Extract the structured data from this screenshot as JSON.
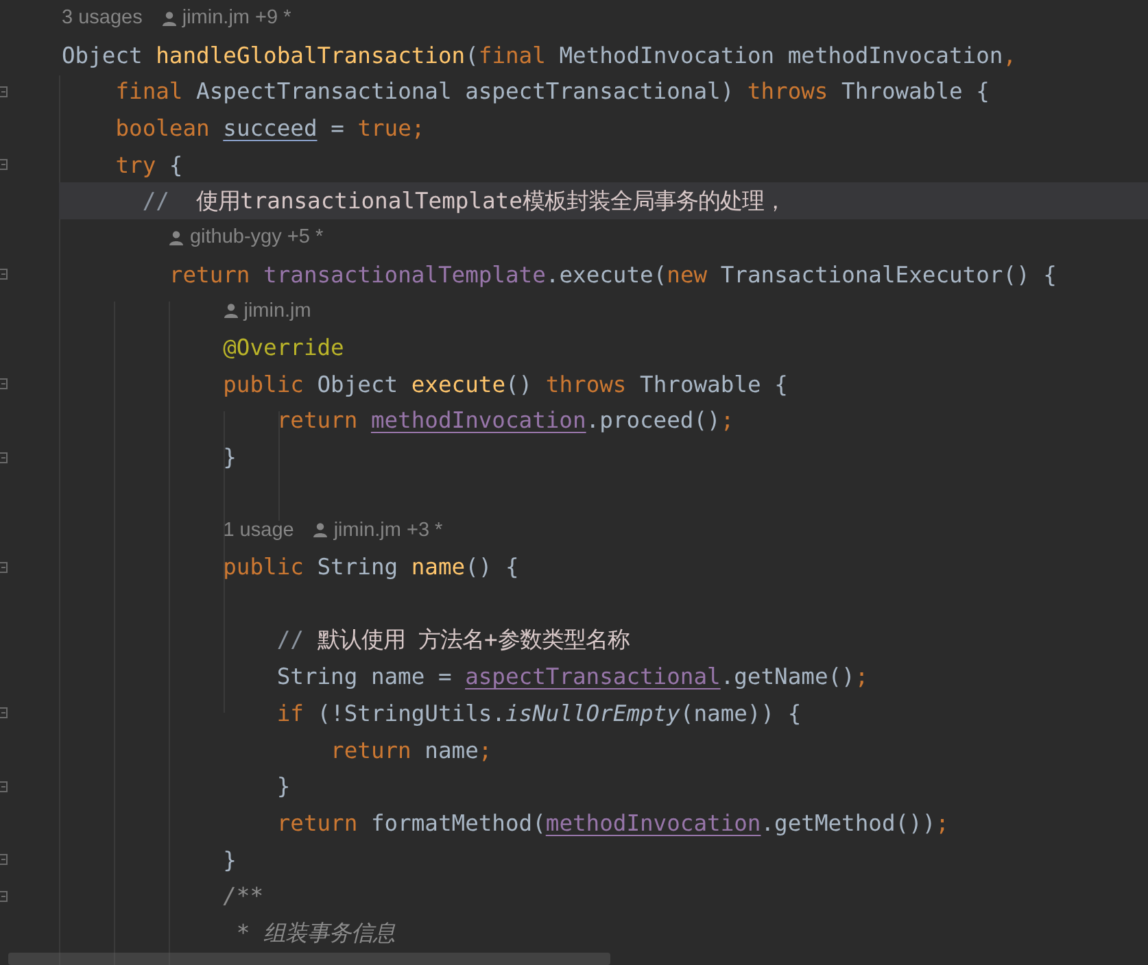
{
  "editor": {
    "lines": [
      {
        "kind": "hint",
        "usages": "3 usages",
        "author": "jimin.jm +9 *"
      },
      {
        "kind": "code",
        "current": false,
        "fold_marker": false,
        "tokens": [
          {
            "kind": "type",
            "text": "Object "
          },
          {
            "kind": "fn",
            "text": "handleGlobalTransaction"
          },
          {
            "kind": "plain",
            "text": "("
          },
          {
            "kind": "kw",
            "text": "final "
          },
          {
            "kind": "plain",
            "text": "MethodInvocation methodInvocation"
          },
          {
            "kind": "punct",
            "text": ","
          }
        ]
      },
      {
        "kind": "code",
        "current": false,
        "fold_marker": true,
        "tokens": [
          {
            "kind": "kw",
            "text": "    final "
          },
          {
            "kind": "plain",
            "text": "AspectTransactional aspectTransactional) "
          },
          {
            "kind": "kw",
            "text": "throws "
          },
          {
            "kind": "plain",
            "text": "Throwable {"
          }
        ]
      },
      {
        "kind": "code",
        "current": false,
        "fold_marker": false,
        "tokens": [
          {
            "kind": "kw",
            "text": "    boolean "
          },
          {
            "kind": "local",
            "text": "succeed"
          },
          {
            "kind": "plain",
            "text": " = "
          },
          {
            "kind": "kw",
            "text": "true;"
          }
        ]
      },
      {
        "kind": "code",
        "current": false,
        "fold_marker": true,
        "tokens": [
          {
            "kind": "kw",
            "text": "    try "
          },
          {
            "kind": "plain",
            "text": "{"
          }
        ]
      },
      {
        "kind": "code",
        "current": true,
        "fold_marker": false,
        "tokens": [
          {
            "kind": "comment",
            "text": "      //  "
          },
          {
            "kind": "comment_text",
            "text": "使用transactionalTemplate模板封装全局事务的处理，"
          }
        ]
      },
      {
        "kind": "hint",
        "author": "github-ygy +5 *"
      },
      {
        "kind": "code",
        "current": false,
        "fold_marker": true,
        "tokens": [
          {
            "kind": "kw",
            "text": "        return "
          },
          {
            "kind": "field",
            "text": "transactionalTemplate"
          },
          {
            "kind": "plain",
            "text": ".execute("
          },
          {
            "kind": "kw",
            "text": "new "
          },
          {
            "kind": "plain",
            "text": "TransactionalExecutor() {"
          }
        ]
      },
      {
        "kind": "hint",
        "author": "jimin.jm"
      },
      {
        "kind": "code",
        "current": false,
        "fold_marker": false,
        "tokens": [
          {
            "kind": "annot",
            "text": "            @Override"
          }
        ]
      },
      {
        "kind": "code",
        "current": false,
        "fold_marker": true,
        "tokens": [
          {
            "kind": "kw",
            "text": "            public "
          },
          {
            "kind": "plain",
            "text": "Object "
          },
          {
            "kind": "fn",
            "text": "execute"
          },
          {
            "kind": "plain",
            "text": "() "
          },
          {
            "kind": "kw",
            "text": "throws "
          },
          {
            "kind": "plain",
            "text": "Throwable {"
          }
        ]
      },
      {
        "kind": "code",
        "current": false,
        "fold_marker": false,
        "tokens": [
          {
            "kind": "kw",
            "text": "                return "
          },
          {
            "kind": "field_ref",
            "text": "methodInvocation"
          },
          {
            "kind": "plain",
            "text": ".proceed()"
          },
          {
            "kind": "punct",
            "text": ";"
          }
        ]
      },
      {
        "kind": "code",
        "current": false,
        "fold_marker": true,
        "tokens": [
          {
            "kind": "plain",
            "text": "            }"
          }
        ]
      },
      {
        "kind": "blank"
      },
      {
        "kind": "hint",
        "usages": "1 usage",
        "author": "jimin.jm +3 *"
      },
      {
        "kind": "code",
        "current": false,
        "fold_marker": true,
        "tokens": [
          {
            "kind": "kw",
            "text": "            public "
          },
          {
            "kind": "plain",
            "text": "String "
          },
          {
            "kind": "fn",
            "text": "name"
          },
          {
            "kind": "plain",
            "text": "() {"
          }
        ]
      },
      {
        "kind": "blank"
      },
      {
        "kind": "code",
        "current": false,
        "fold_marker": false,
        "tokens": [
          {
            "kind": "comment",
            "text": "                // "
          },
          {
            "kind": "comment_text",
            "text": "默认使用 方法名+参数类型名称"
          }
        ]
      },
      {
        "kind": "code",
        "current": false,
        "fold_marker": false,
        "tokens": [
          {
            "kind": "plain",
            "text": "                String name = "
          },
          {
            "kind": "field_ref",
            "text": "aspectTransactional"
          },
          {
            "kind": "plain",
            "text": ".getName()"
          },
          {
            "kind": "punct",
            "text": ";"
          }
        ]
      },
      {
        "kind": "code",
        "current": false,
        "fold_marker": true,
        "tokens": [
          {
            "kind": "kw",
            "text": "                if "
          },
          {
            "kind": "plain",
            "text": "(!StringUtils."
          },
          {
            "kind": "static",
            "text": "isNullOrEmpty"
          },
          {
            "kind": "plain",
            "text": "(name)) {"
          }
        ]
      },
      {
        "kind": "code",
        "current": false,
        "fold_marker": false,
        "tokens": [
          {
            "kind": "kw",
            "text": "                    return "
          },
          {
            "kind": "plain",
            "text": "name"
          },
          {
            "kind": "punct",
            "text": ";"
          }
        ]
      },
      {
        "kind": "code",
        "current": false,
        "fold_marker": true,
        "tokens": [
          {
            "kind": "plain",
            "text": "                }"
          }
        ]
      },
      {
        "kind": "code",
        "current": false,
        "fold_marker": false,
        "tokens": [
          {
            "kind": "kw",
            "text": "                return "
          },
          {
            "kind": "plain",
            "text": "formatMethod("
          },
          {
            "kind": "field_ref",
            "text": "methodInvocation"
          },
          {
            "kind": "plain",
            "text": ".getMethod())"
          },
          {
            "kind": "punct",
            "text": ";"
          }
        ]
      },
      {
        "kind": "code",
        "current": false,
        "fold_marker": true,
        "tokens": [
          {
            "kind": "plain",
            "text": "            }"
          }
        ]
      },
      {
        "kind": "code",
        "current": false,
        "fold_marker": true,
        "tokens": [
          {
            "kind": "doc",
            "text": "            /**"
          }
        ]
      },
      {
        "kind": "code",
        "current": false,
        "fold_marker": false,
        "tokens": [
          {
            "kind": "doc",
            "text": "             * 组装事务信息"
          }
        ]
      }
    ]
  }
}
